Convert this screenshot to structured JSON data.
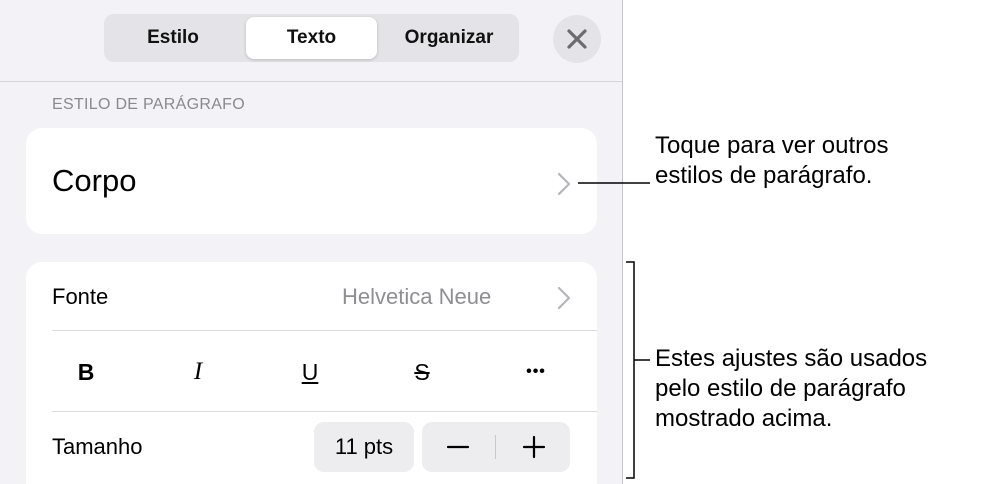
{
  "tabs": [
    {
      "label": "Estilo",
      "selected": false
    },
    {
      "label": "Texto",
      "selected": true
    },
    {
      "label": "Organizar",
      "selected": false
    }
  ],
  "section_label": "ESTILO DE PARÁGRAFO",
  "paragraph_style": "Corpo",
  "font": {
    "label": "Fonte",
    "value": "Helvetica Neue"
  },
  "format_buttons": {
    "bold": "B",
    "italic": "I",
    "underline": "U",
    "strikethrough": "S",
    "more": "•••"
  },
  "size": {
    "label": "Tamanho",
    "value": "11 pts",
    "decrement": "−",
    "increment": "+"
  },
  "callouts": {
    "style": [
      "Toque para ver outros",
      "estilos de parágrafo."
    ],
    "settings": [
      "Estes ajustes são usados",
      "pelo estilo de parágrafo",
      "mostrado acima."
    ]
  },
  "colors": {
    "panel_bg": "#f2f2f7",
    "card_bg": "#ffffff",
    "secondary_text": "#8e8e93"
  },
  "icons": {
    "close": "close-icon",
    "chevron": "chevron-right-icon"
  }
}
